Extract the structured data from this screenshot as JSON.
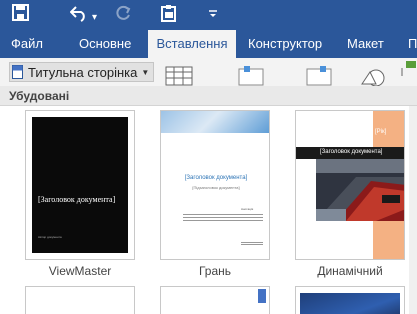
{
  "quick_access": {
    "save_icon": "save-icon",
    "undo_icon": "undo-icon",
    "undo_menu_glyph": "▾",
    "redo_icon": "redo-icon",
    "clipboard_icon": "clipboard-icon",
    "customize_icon": "customize-qat-icon"
  },
  "tabs": [
    {
      "label": "Файл"
    },
    {
      "label": "Основне"
    },
    {
      "label": "Вставлення",
      "active": true
    },
    {
      "label": "Конструктор"
    },
    {
      "label": "Макет"
    },
    {
      "label": "П"
    }
  ],
  "ribbon": {
    "cover_page_label": "Титульна сторінка"
  },
  "gallery": {
    "section_title": "Убудовані",
    "items": [
      {
        "name": "ViewMaster",
        "title_text": "[Заголовок документа]",
        "body_text": "Автор документа"
      },
      {
        "name": "Грань",
        "title_text": "[Заголовок документа]",
        "subtitle_text": "[Підзаголовок документа]",
        "body_text": "Анотація"
      },
      {
        "name": "Динамічний",
        "title_text": "[Заголовок документа]",
        "year_text": "[Рік]"
      }
    ]
  },
  "colors": {
    "ribbon_blue": "#2b579a",
    "accent_orange": "#f4b183"
  }
}
